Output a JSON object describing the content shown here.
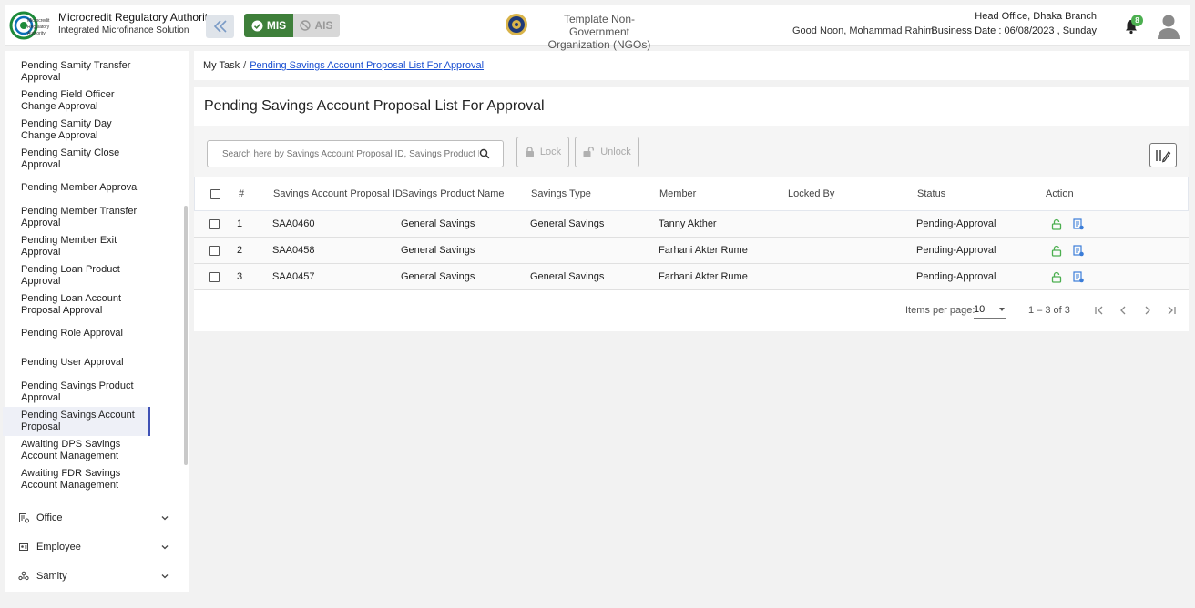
{
  "header": {
    "logo_text": "Microcredit Regulatory Authority",
    "brand_title": "Microcredit Regulatory Authority",
    "brand_subtitle": "Integrated Microfinance Solution",
    "mis_label": "MIS",
    "ais_label": "AIS",
    "org_name_line1": "Template Non-Government",
    "org_name_line2": "Organization (NGOs)",
    "greeting": "Good Noon, Mohammad Rahim",
    "branch": "Head Office, Dhaka Branch",
    "business_date": "Business Date : 06/08/2023 , Sunday",
    "notification_count": "8",
    "icons": [
      "double-chevron-left-icon",
      "check-circle-icon",
      "ban-icon",
      "bell-icon",
      "user-avatar-icon"
    ],
    "colors": {
      "mis": "#3e7f3a",
      "badge": "#4caf50",
      "link": "#1a4fd1",
      "active_bar": "#3f51b5"
    }
  },
  "sidebar": {
    "items": [
      {
        "label_1": "Pending Samity Transfer",
        "label_2": "Approval"
      },
      {
        "label_1": "Pending Field Officer",
        "label_2": "Change Approval"
      },
      {
        "label_1": "Pending Samity Day",
        "label_2": "Change Approval"
      },
      {
        "label_1": "Pending Samity Close",
        "label_2": "Approval"
      },
      {
        "label_1": "Pending Member Approval",
        "label_2": ""
      },
      {
        "label_1": "Pending Member Transfer",
        "label_2": "Approval"
      },
      {
        "label_1": "Pending Member Exit",
        "label_2": "Approval"
      },
      {
        "label_1": "Pending Loan Product",
        "label_2": "Approval"
      },
      {
        "label_1": "Pending Loan Account",
        "label_2": "Proposal Approval"
      },
      {
        "label_1": "Pending Role Approval",
        "label_2": ""
      },
      {
        "label_1": "Pending User Approval",
        "label_2": ""
      },
      {
        "label_1": "Pending Savings Product",
        "label_2": "Approval"
      },
      {
        "label_1": "Pending Savings Account",
        "label_2": "Proposal"
      },
      {
        "label_1": "Awaiting DPS Savings",
        "label_2": "Account Management"
      },
      {
        "label_1": "Awaiting FDR Savings",
        "label_2": "Account Management"
      }
    ],
    "groups": [
      {
        "label": "Office",
        "icon": "office-icon"
      },
      {
        "label": "Employee",
        "icon": "employee-icon"
      },
      {
        "label": "Samity",
        "icon": "samity-icon"
      }
    ]
  },
  "breadcrumb": {
    "root": "My Task",
    "separator": "/",
    "current": "Pending Savings Account Proposal List For Approval"
  },
  "main": {
    "title": "Pending Savings Account Proposal List For Approval",
    "search_placeholder": "Search here by Savings Account Proposal ID, Savings Product Name, Savings Type, Member",
    "lock_label": "Lock",
    "unlock_label": "Unlock",
    "columns": [
      "#",
      "Savings Account Proposal ID",
      "Savings Product Name",
      "Savings Type",
      "Member",
      "Locked By",
      "Status",
      "Action"
    ],
    "rows": [
      {
        "num": "1",
        "id": "SAA0460",
        "product": "General Savings",
        "type": "General Savings",
        "member": "Tanny Akther",
        "locked_by": "",
        "status": "Pending-Approval"
      },
      {
        "num": "2",
        "id": "SAA0458",
        "product": "General Savings",
        "type": "",
        "member": "Farhani Akter Rume",
        "locked_by": "",
        "status": "Pending-Approval"
      },
      {
        "num": "3",
        "id": "SAA0457",
        "product": "General Savings",
        "type": "General Savings",
        "member": "Farhani Akter Rume",
        "locked_by": "",
        "status": "Pending-Approval"
      }
    ],
    "pager": {
      "items_per_page_label": "Items per page:",
      "items_per_page": "10",
      "range": "1 – 3 of 3"
    }
  }
}
